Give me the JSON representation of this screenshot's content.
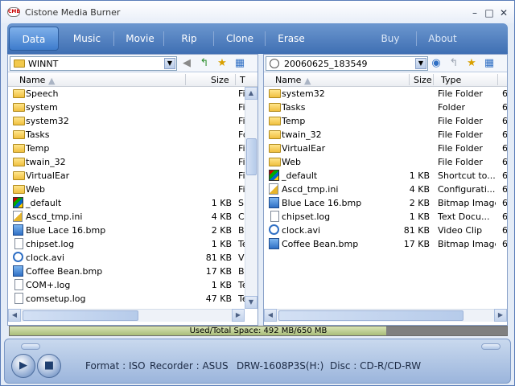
{
  "window": {
    "title": "Cistone Media Burner",
    "app_icon_text": "CMB",
    "min_icon": "minimize-icon",
    "max_icon": "maximize-icon",
    "close_icon": "close-icon"
  },
  "tabs": [
    {
      "label": "Data",
      "active": true
    },
    {
      "label": "Music",
      "active": false
    },
    {
      "label": "Movie",
      "active": false
    },
    {
      "label": "Rip",
      "active": false
    },
    {
      "label": "Clone",
      "active": false
    },
    {
      "label": "Erase",
      "active": false
    },
    {
      "label": "Buy",
      "active": false
    },
    {
      "label": "About",
      "active": false
    }
  ],
  "left_pane": {
    "path": "WINNT",
    "columns": {
      "name": "Name",
      "size": "Size",
      "type": "T"
    },
    "rows": [
      {
        "name": "Speech",
        "size": "",
        "type": "Fi",
        "icon": "folder"
      },
      {
        "name": "system",
        "size": "",
        "type": "Fi",
        "icon": "folder"
      },
      {
        "name": "system32",
        "size": "",
        "type": "Fi",
        "icon": "folder"
      },
      {
        "name": "Tasks",
        "size": "",
        "type": "Fo",
        "icon": "folder"
      },
      {
        "name": "Temp",
        "size": "",
        "type": "Fi",
        "icon": "folder"
      },
      {
        "name": "twain_32",
        "size": "",
        "type": "Fi",
        "icon": "folder"
      },
      {
        "name": "VirtualEar",
        "size": "",
        "type": "Fi",
        "icon": "folder"
      },
      {
        "name": "Web",
        "size": "",
        "type": "Fi",
        "icon": "folder"
      },
      {
        "name": "_default",
        "size": "1 KB",
        "type": "Sl",
        "icon": "sys"
      },
      {
        "name": "Ascd_tmp.ini",
        "size": "4 KB",
        "type": "C",
        "icon": "config"
      },
      {
        "name": "Blue Lace 16.bmp",
        "size": "2 KB",
        "type": "Bi",
        "icon": "image"
      },
      {
        "name": "chipset.log",
        "size": "1 KB",
        "type": "Te",
        "icon": "file"
      },
      {
        "name": "clock.avi",
        "size": "81 KB",
        "type": "Vi",
        "icon": "video"
      },
      {
        "name": "Coffee Bean.bmp",
        "size": "17 KB",
        "type": "Bi",
        "icon": "image"
      },
      {
        "name": "COM+.log",
        "size": "1 KB",
        "type": "Te",
        "icon": "file"
      },
      {
        "name": "comsetup.log",
        "size": "47 KB",
        "type": "Te",
        "icon": "file"
      }
    ]
  },
  "right_pane": {
    "path": "20060625_183549",
    "columns": {
      "name": "Name",
      "size": "Size",
      "type": "Type"
    },
    "rows": [
      {
        "name": "system32",
        "size": "",
        "type": "File Folder",
        "extra": "6",
        "icon": "folder"
      },
      {
        "name": "Tasks",
        "size": "",
        "type": "Folder",
        "extra": "6",
        "icon": "folder"
      },
      {
        "name": "Temp",
        "size": "",
        "type": "File Folder",
        "extra": "6",
        "icon": "folder"
      },
      {
        "name": "twain_32",
        "size": "",
        "type": "File Folder",
        "extra": "6",
        "icon": "folder"
      },
      {
        "name": "VirtualEar",
        "size": "",
        "type": "File Folder",
        "extra": "6",
        "icon": "folder"
      },
      {
        "name": "Web",
        "size": "",
        "type": "File Folder",
        "extra": "6",
        "icon": "folder"
      },
      {
        "name": "_default",
        "size": "1 KB",
        "type": "Shortcut to...",
        "extra": "6",
        "icon": "sys"
      },
      {
        "name": "Ascd_tmp.ini",
        "size": "4 KB",
        "type": "Configurati...",
        "extra": "6",
        "icon": "config"
      },
      {
        "name": "Blue Lace 16.bmp",
        "size": "2 KB",
        "type": "Bitmap Image",
        "extra": "6",
        "icon": "image"
      },
      {
        "name": "chipset.log",
        "size": "1 KB",
        "type": "Text Docu...",
        "extra": "6",
        "icon": "file"
      },
      {
        "name": "clock.avi",
        "size": "81 KB",
        "type": "Video Clip",
        "extra": "6",
        "icon": "video"
      },
      {
        "name": "Coffee Bean.bmp",
        "size": "17 KB",
        "type": "Bitmap Image",
        "extra": "6",
        "icon": "image"
      }
    ]
  },
  "space": {
    "label": "Used/Total Space: 492 MB/650 MB",
    "used_fraction": 0.757
  },
  "status": {
    "format": "Format : ISO",
    "recorder": "Recorder : ASUS",
    "drive": "DRW-1608P3S(H:)",
    "disc": "Disc : CD-R/CD-RW"
  }
}
